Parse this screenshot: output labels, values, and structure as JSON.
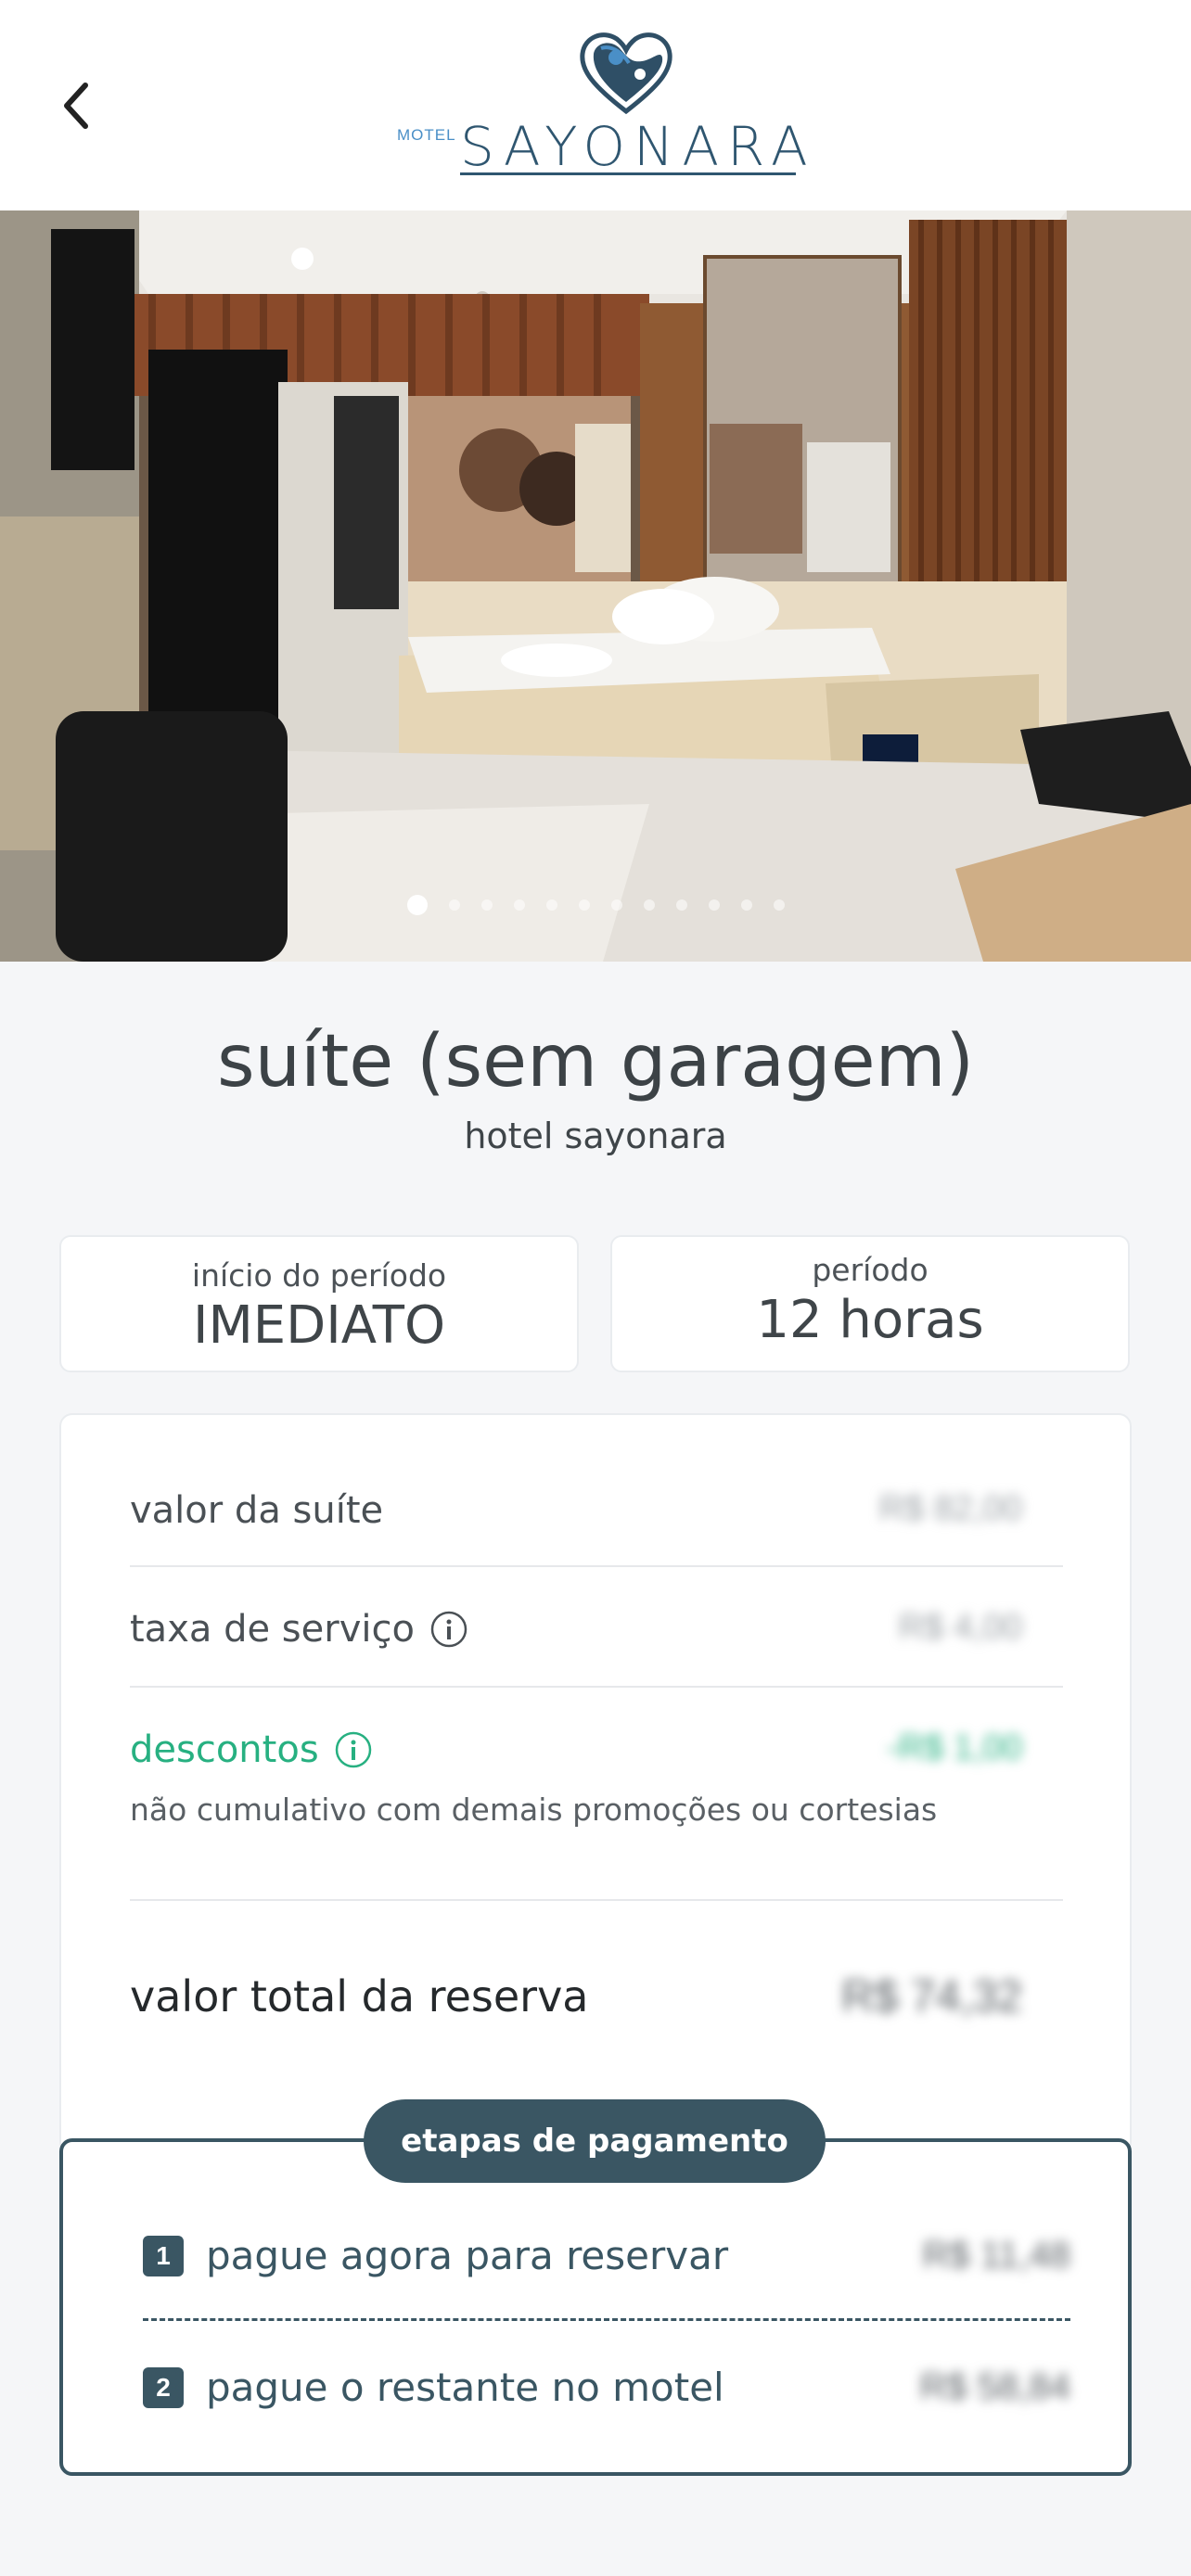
{
  "header": {
    "logo_small": "MOTEL",
    "logo_name": "SAYONARA"
  },
  "gallery": {
    "slide_count": 12,
    "active_index": 0
  },
  "suite": {
    "title": "suíte (sem garagem)",
    "hotel": "hotel sayonara"
  },
  "period_start": {
    "label": "início do período",
    "value": "IMEDIATO"
  },
  "period_length": {
    "label": "período",
    "value": "12 horas"
  },
  "pricing": {
    "suite_value_label": "valor da suíte",
    "suite_value_amount": "R$ 82,00",
    "service_fee_label": "taxa de serviço",
    "service_fee_amount": "R$ 4,00",
    "discount_label": "descontos",
    "discount_amount": "-R$ 1,00",
    "discount_note": "não cumulativo com demais promoções ou cortesias",
    "total_label": "valor total da reserva",
    "total_amount": "R$ 74,32"
  },
  "payment_steps": {
    "title": "etapas de pagamento",
    "steps": [
      {
        "number": "1",
        "label": "pague agora para reservar",
        "amount": "R$ 11,48"
      },
      {
        "number": "2",
        "label": "pague o restante no motel",
        "amount": "R$ 58,84"
      }
    ]
  },
  "colors": {
    "primary": "#3a5663",
    "discount": "#27b081",
    "logo_blue": "#4a8fc7"
  }
}
